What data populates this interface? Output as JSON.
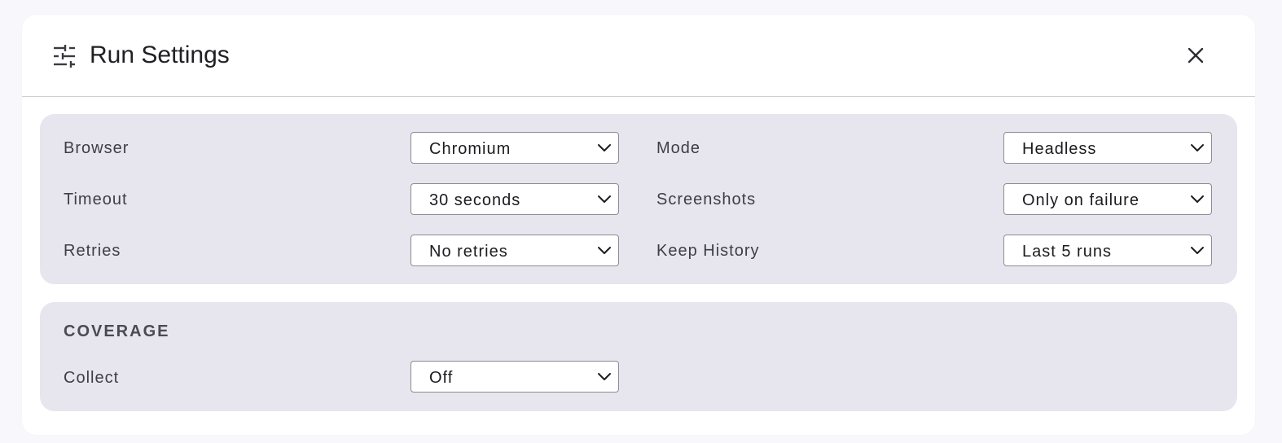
{
  "dialog": {
    "title": "Run Settings",
    "icon": "sliders-icon",
    "close_icon": "close-icon"
  },
  "run_options": [
    {
      "label": "Browser",
      "value": "Chromium"
    },
    {
      "label": "Mode",
      "value": "Headless"
    },
    {
      "label": "Timeout",
      "value": "30 seconds"
    },
    {
      "label": "Screenshots",
      "value": "Only on failure"
    },
    {
      "label": "Retries",
      "value": "No retries"
    },
    {
      "label": "Keep History",
      "value": "Last 5 runs"
    }
  ],
  "coverage": {
    "section_title": "COVERAGE",
    "collect": {
      "label": "Collect",
      "value": "Off"
    }
  },
  "colors": {
    "page_background": "#f8f8fc",
    "panel_background": "#e7e6ef",
    "select_border": "#8c8c96",
    "text": "#1f1f23"
  }
}
